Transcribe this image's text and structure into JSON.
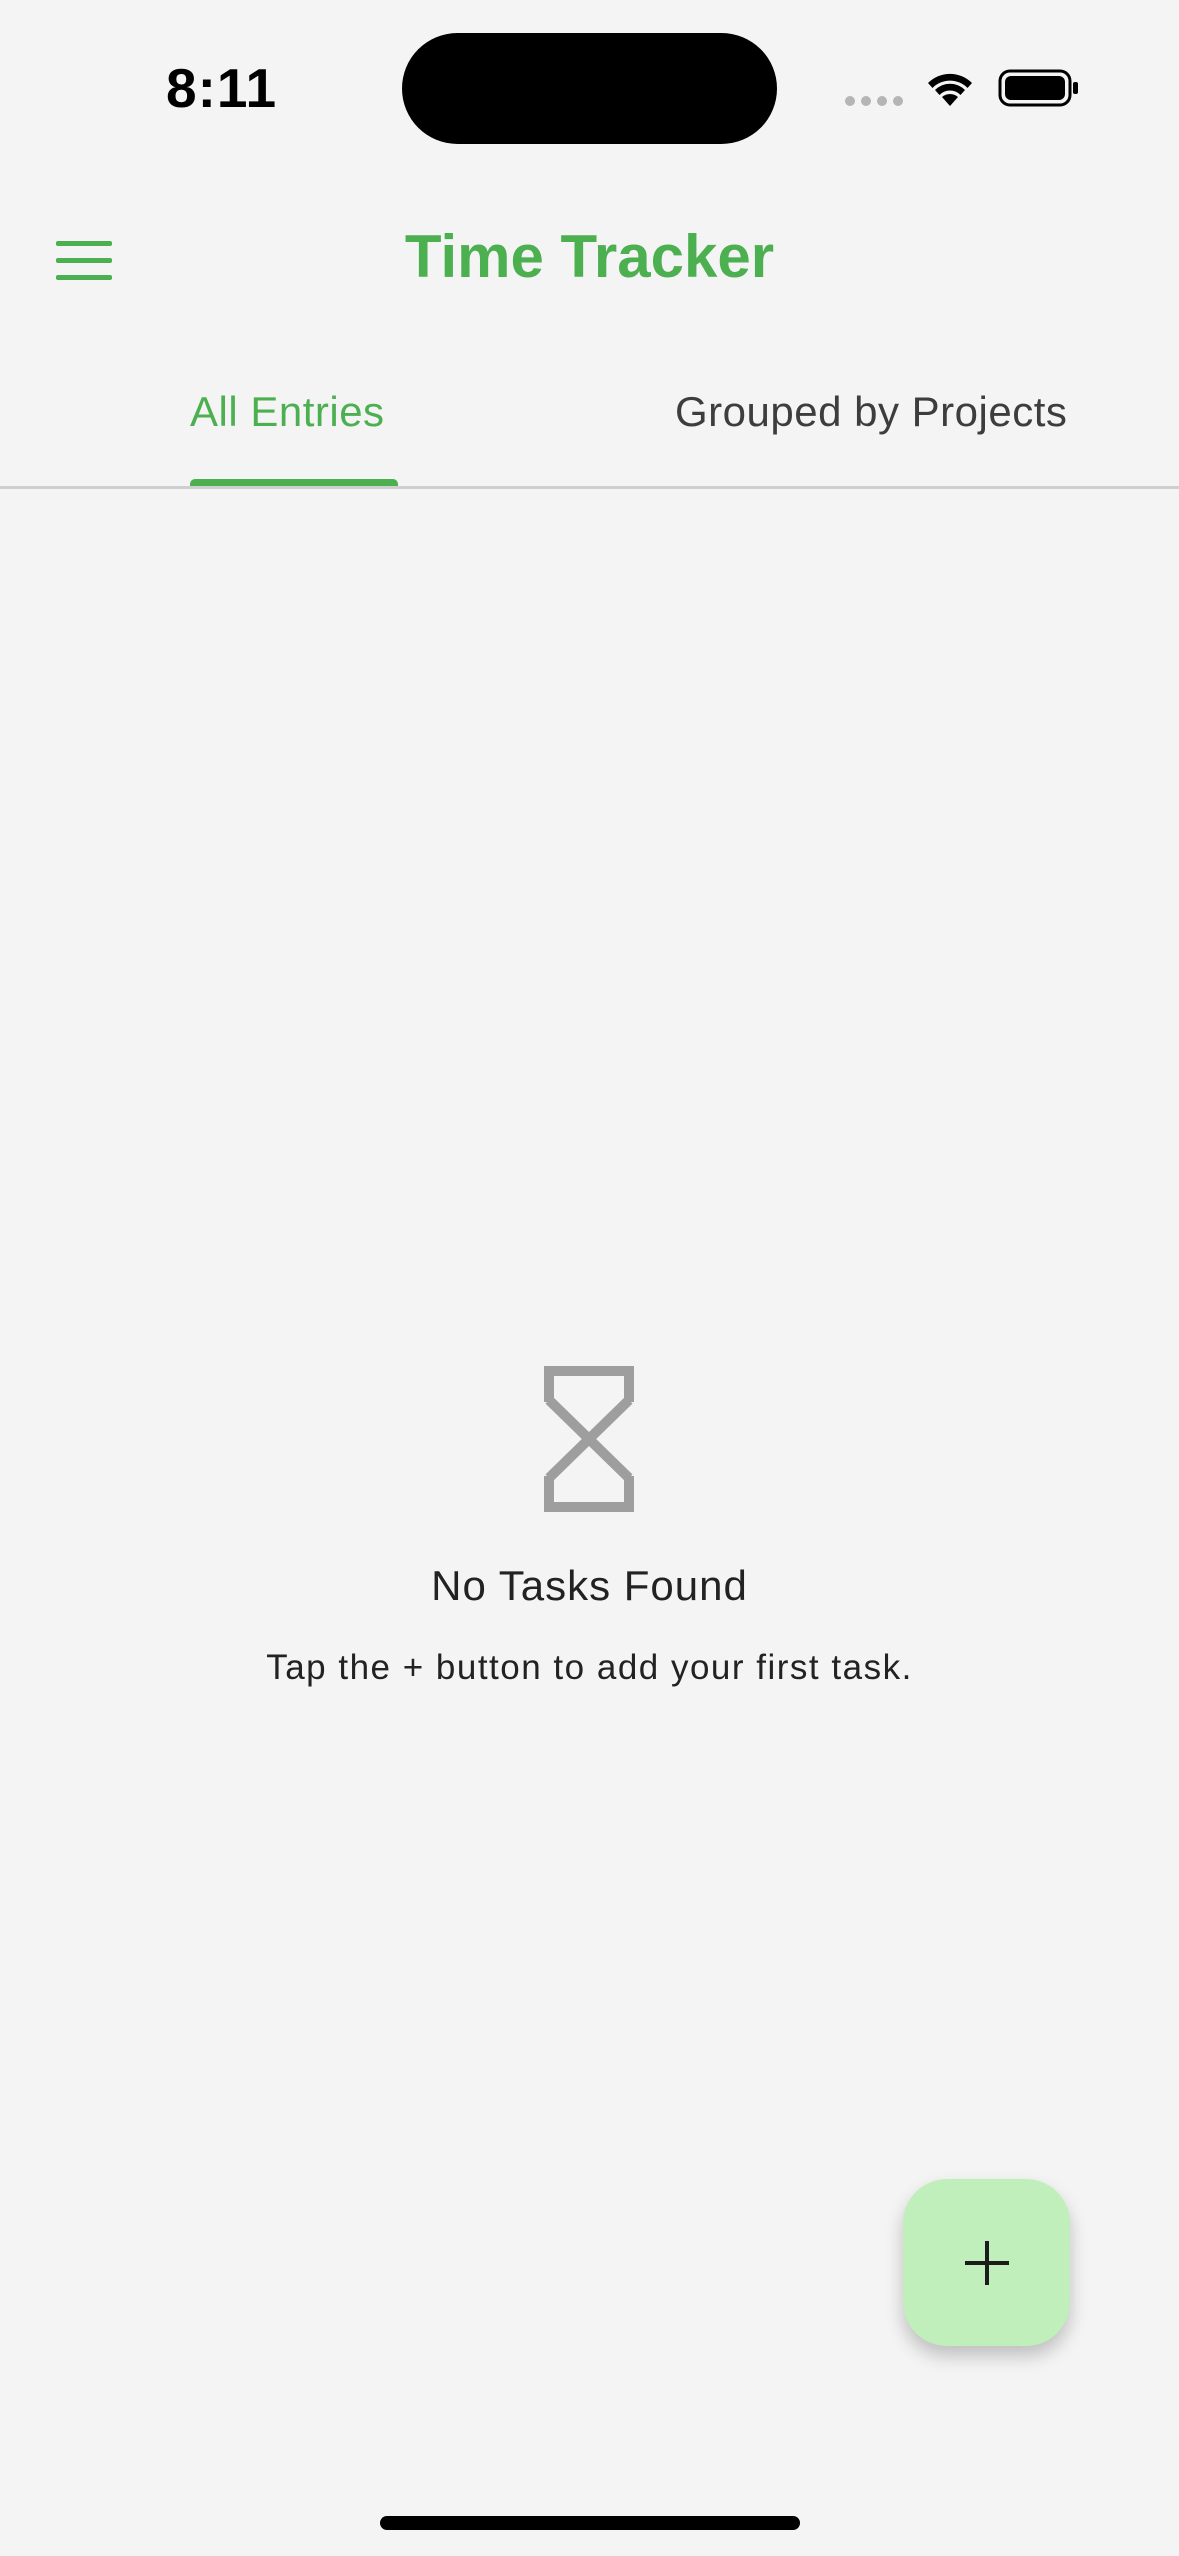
{
  "status_bar": {
    "time": "8:11"
  },
  "app_bar": {
    "title": "Time Tracker",
    "menu_icon": "hamburger-menu-icon"
  },
  "tabs": [
    {
      "label": "All Entries",
      "selected": true
    },
    {
      "label": "Grouped by Projects",
      "selected": false
    }
  ],
  "empty_state": {
    "icon": "hourglass-icon",
    "title": "No Tasks Found",
    "subtitle": "Tap the + button to add your first task."
  },
  "fab": {
    "icon": "plus-icon"
  },
  "colors": {
    "accent": "#4caf50",
    "background": "#f4f4f4",
    "fab_background": "#c1efbb",
    "icon_gray": "#9e9e9e"
  }
}
